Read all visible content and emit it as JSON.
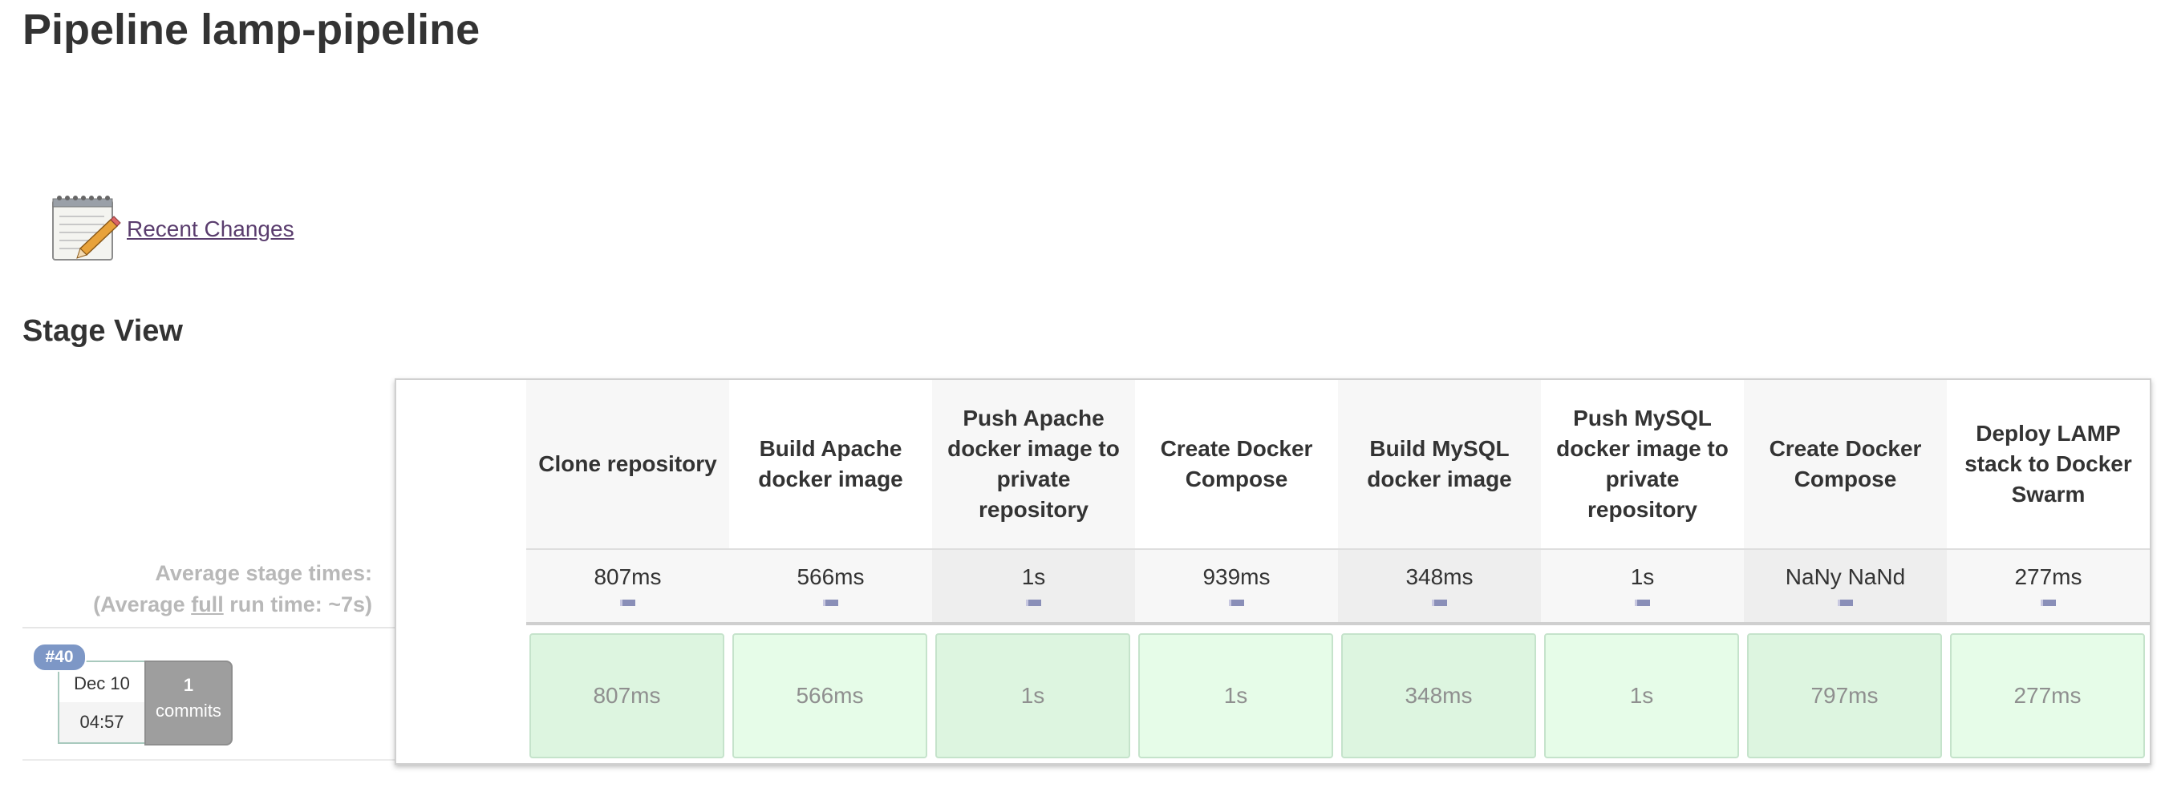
{
  "page": {
    "title": "Pipeline lamp-pipeline"
  },
  "recent_changes": {
    "label": "Recent Changes",
    "icon": "notepad-icon"
  },
  "stage_view": {
    "title": "Stage View",
    "average_label": "Average stage times:",
    "average_full_prefix": "(Average ",
    "average_full_word": "full",
    "average_full_suffix": " run time: ~7s)",
    "stages": [
      {
        "name": "Clone repository",
        "avg": "807ms",
        "run": "807ms"
      },
      {
        "name": "Build Apache docker image",
        "avg": "566ms",
        "run": "566ms"
      },
      {
        "name": "Push Apache docker image to private repository",
        "avg": "1s",
        "run": "1s"
      },
      {
        "name": "Create Docker Compose",
        "avg": "939ms",
        "run": "1s"
      },
      {
        "name": "Build MySQL docker image",
        "avg": "348ms",
        "run": "348ms"
      },
      {
        "name": "Push MySQL docker image to private repository",
        "avg": "1s",
        "run": "1s"
      },
      {
        "name": "Create Docker Compose",
        "avg": "NaNy NaNd",
        "run": "797ms"
      },
      {
        "name": "Deploy LAMP stack to Docker Swarm",
        "avg": "277ms",
        "run": "277ms"
      }
    ],
    "build": {
      "number": "#40",
      "date": "Dec 10",
      "time": "04:57",
      "commit_count": "1",
      "commit_label": "commits"
    }
  },
  "colors": {
    "success_cell": "#ddf5e0",
    "success_border": "#c5e3cb",
    "badge": "#7d97c6",
    "link": "#5a3d6e"
  }
}
